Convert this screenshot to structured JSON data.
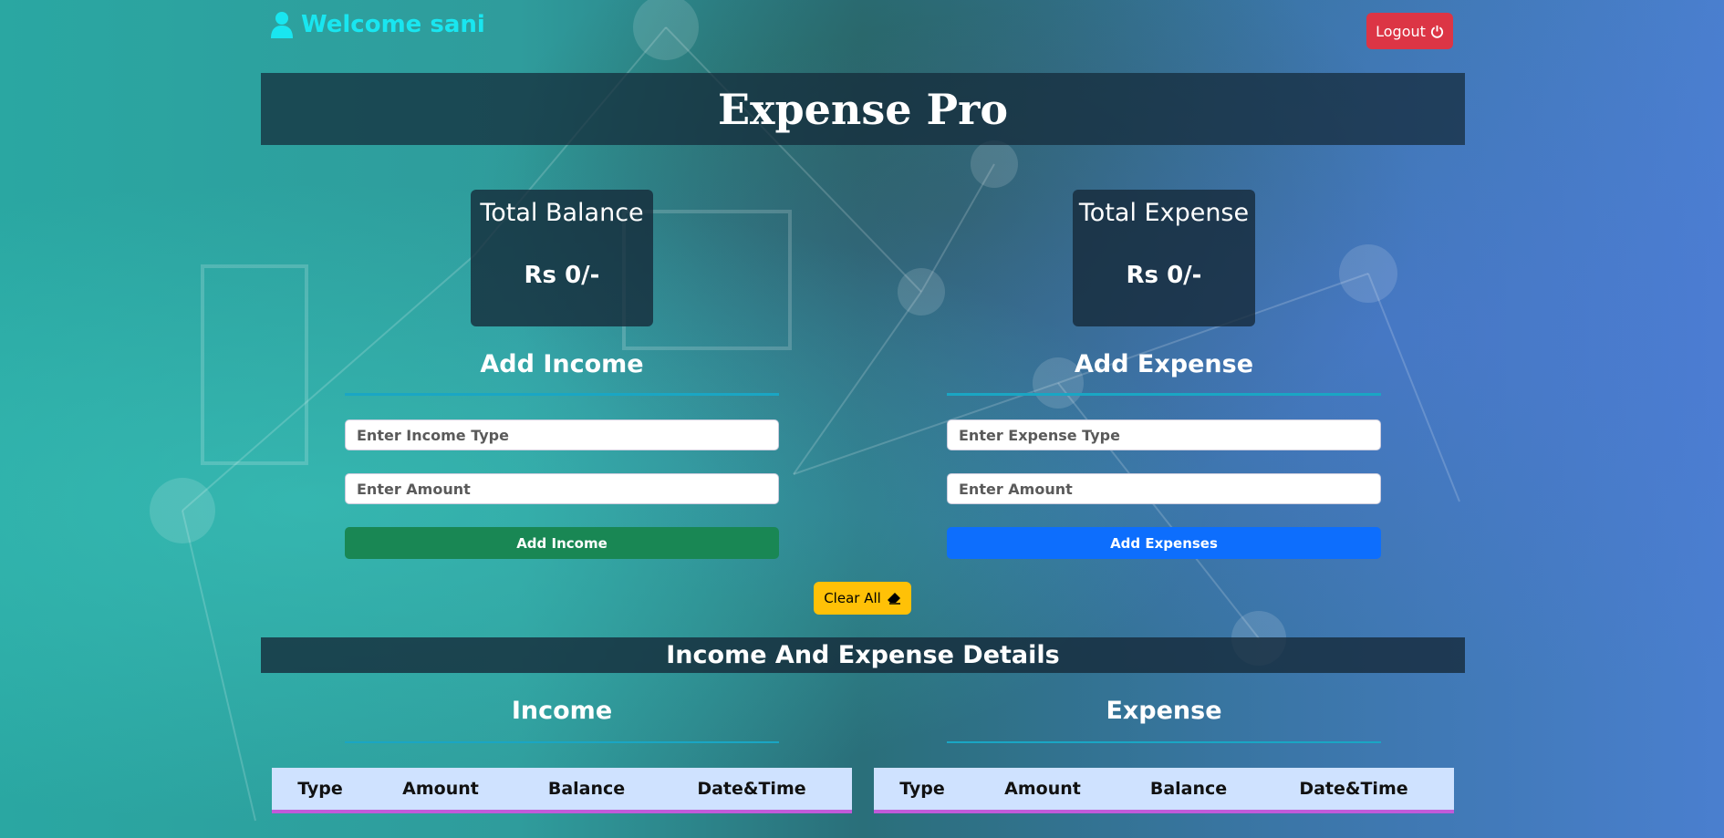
{
  "header": {
    "welcome_text": "Welcome sani",
    "logout_label": "Logout"
  },
  "app_title": "Expense Pro",
  "cards": {
    "balance": {
      "title": "Total Balance",
      "value": "Rs 0/-"
    },
    "expense": {
      "title": "Total Expense",
      "value": "Rs 0/-"
    }
  },
  "income_form": {
    "title": "Add Income",
    "type_placeholder": "Enter Income Type",
    "amount_placeholder": "Enter Amount",
    "button_label": "Add Income"
  },
  "expense_form": {
    "title": "Add Expense",
    "type_placeholder": "Enter Expense Type",
    "amount_placeholder": "Enter Amount",
    "button_label": "Add Expenses"
  },
  "clear_label": "Clear All",
  "details": {
    "title": "Income And Expense Details",
    "income_title": "Income",
    "expense_title": "Expense",
    "columns": [
      "Type",
      "Amount",
      "Balance",
      "Date&Time"
    ]
  },
  "colors": {
    "welcome": "#19e6f0",
    "logout": "#dc3545",
    "add_income": "#198754",
    "add_expense": "#0d6efd",
    "clear_all": "#ffc107",
    "table_header": "#cfe2ff",
    "table_border": "#c15ad9"
  },
  "icons": {
    "welcome": "user-icon",
    "logout": "power-icon",
    "clear": "eraser-icon"
  }
}
